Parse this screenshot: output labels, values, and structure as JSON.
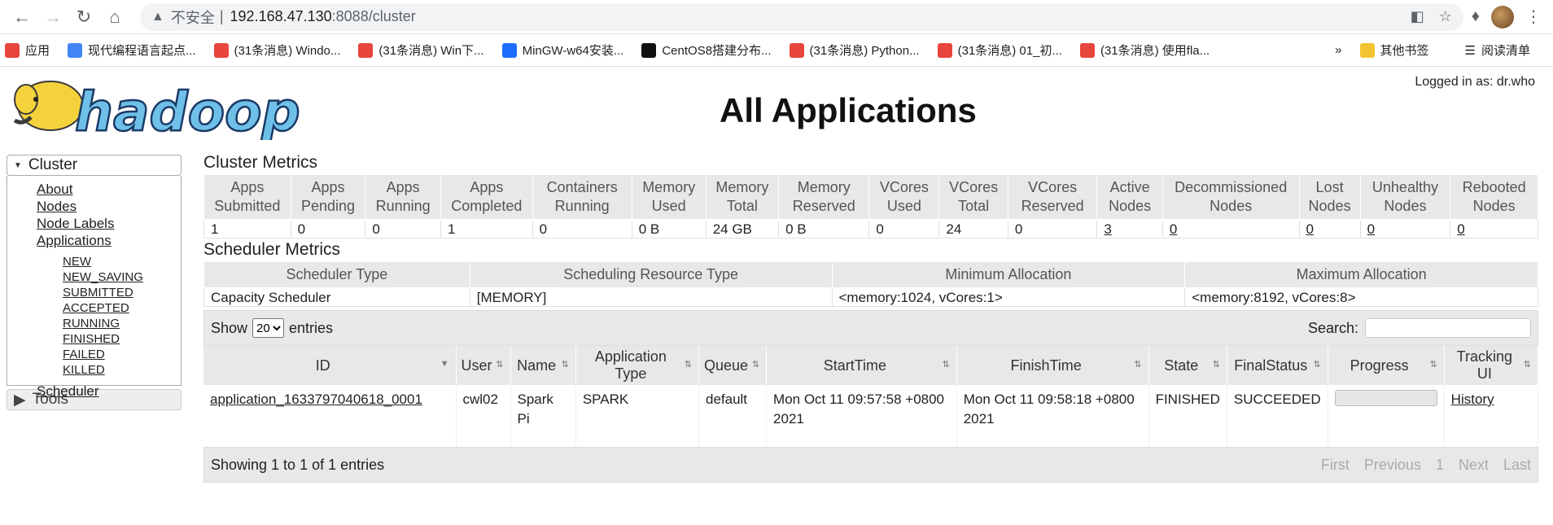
{
  "browser": {
    "insecure_label": "不安全",
    "host": "192.168.47.130",
    "path": ":8088/cluster"
  },
  "bookmarks": {
    "items": [
      {
        "label": "应用",
        "color": "#e8453c"
      },
      {
        "label": "现代编程语言起点...",
        "color": "#4285f4"
      },
      {
        "label": "(31条消息) Windo...",
        "color": "#e8453c"
      },
      {
        "label": "(31条消息) Win下...",
        "color": "#e8453c"
      },
      {
        "label": "MinGW-w64安装...",
        "color": "#1e6fff"
      },
      {
        "label": "CentOS8搭建分布...",
        "color": "#111"
      },
      {
        "label": "(31条消息) Python...",
        "color": "#e8453c"
      },
      {
        "label": "(31条消息) 01_初...",
        "color": "#e8453c"
      },
      {
        "label": "(31条消息) 使用fla...",
        "color": "#e8453c"
      }
    ],
    "other": "其他书签",
    "reading": "阅读清单"
  },
  "header": {
    "logged_in": "Logged in as: dr.who",
    "title": "All Applications",
    "logo_text": "hadoop"
  },
  "nav": {
    "cluster": "Cluster",
    "links": [
      "About",
      "Nodes",
      "Node Labels",
      "Applications"
    ],
    "sublinks": [
      "NEW",
      "NEW_SAVING",
      "SUBMITTED",
      "ACCEPTED",
      "RUNNING",
      "FINISHED",
      "FAILED",
      "KILLED"
    ],
    "scheduler": "Scheduler",
    "tools": "Tools"
  },
  "cluster_metrics": {
    "title": "Cluster Metrics",
    "headers": [
      "Apps Submitted",
      "Apps Pending",
      "Apps Running",
      "Apps Completed",
      "Containers Running",
      "Memory Used",
      "Memory Total",
      "Memory Reserved",
      "VCores Used",
      "VCores Total",
      "VCores Reserved",
      "Active Nodes",
      "Decommissioned Nodes",
      "Lost Nodes",
      "Unhealthy Nodes",
      "Rebooted Nodes"
    ],
    "values": [
      "1",
      "0",
      "0",
      "1",
      "0",
      "0 B",
      "24 GB",
      "0 B",
      "0",
      "24",
      "0",
      "3",
      "0",
      "0",
      "0",
      "0"
    ]
  },
  "scheduler_metrics": {
    "title": "Scheduler Metrics",
    "headers": [
      "Scheduler Type",
      "Scheduling Resource Type",
      "Minimum Allocation",
      "Maximum Allocation"
    ],
    "values": [
      "Capacity Scheduler",
      "[MEMORY]",
      "<memory:1024, vCores:1>",
      "<memory:8192, vCores:8>"
    ]
  },
  "apps": {
    "show": "Show",
    "entries": "entries",
    "page_size": "20",
    "search": "Search:",
    "headers": [
      "ID",
      "User",
      "Name",
      "Application Type",
      "Queue",
      "StartTime",
      "FinishTime",
      "State",
      "FinalStatus",
      "Progress",
      "Tracking UI"
    ],
    "row": {
      "id": "application_1633797040618_0001",
      "user": "cwl02",
      "name": "Spark Pi",
      "type": "SPARK",
      "queue": "default",
      "start": "Mon Oct 11 09:57:58 +0800 2021",
      "finish": "Mon Oct 11 09:58:18 +0800 2021",
      "state": "FINISHED",
      "final": "SUCCEEDED",
      "progress": 1.0,
      "tracking": "History"
    },
    "footer": "Showing 1 to 1 of 1 entries",
    "pager": [
      "First",
      "Previous",
      "1",
      "Next",
      "Last"
    ]
  }
}
